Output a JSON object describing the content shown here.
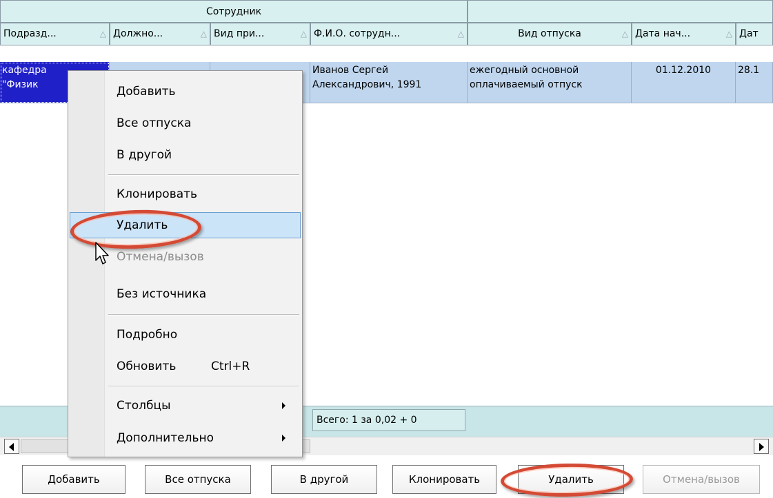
{
  "grid": {
    "group_header": "Сотрудник",
    "columns": [
      {
        "label": "Подразд...",
        "sort": "△"
      },
      {
        "label": "Должно...",
        "sort": "△"
      },
      {
        "label": "Вид при...",
        "sort": "△"
      },
      {
        "label": "Ф.И.О. сотрудн...",
        "sort": "△"
      },
      {
        "label": "Вид отпуска",
        "sort": "△"
      },
      {
        "label": "Дата нач...",
        "sort": "△"
      },
      {
        "label": "Дат"
      }
    ],
    "row": {
      "department": "кафедра\n\"Физик",
      "position": "",
      "hire_type": "",
      "employee": "Иванов Сергей\nАлександрович, 1991",
      "leave_type": "ежегодный основной\nоплачиваемый отпуск",
      "start_date": "01.12.2010",
      "end_date": "28.1"
    },
    "total": "Всего: 1 за 0,02 + 0"
  },
  "context_menu": {
    "items": [
      {
        "label": "Добавить"
      },
      {
        "label": "Все отпуска"
      },
      {
        "label": "В другой"
      },
      {
        "label": "Клонировать"
      },
      {
        "label": "Удалить"
      },
      {
        "label": "Отмена/вызов"
      },
      {
        "label": "Без источника"
      },
      {
        "label": "Подробно"
      },
      {
        "label": "Обновить",
        "shortcut": "Ctrl+R"
      },
      {
        "label": "Столбцы"
      },
      {
        "label": "Дополнительно"
      }
    ]
  },
  "buttons": {
    "add": "Добавить",
    "all_leaves": "Все отпуска",
    "to_other": "В другой",
    "clone": "Клонировать",
    "delete": "Удалить",
    "cancel_recall": "Отмена/вызов"
  },
  "colors": {
    "header_bg": "#d8f0f0",
    "row_bg": "#bfd6ee",
    "selected_cell": "#2020c8",
    "menu_highlight": "#cce4f7",
    "highlight_oval": "#d44a34"
  },
  "icons": {
    "sort": "sort-triangle-icon",
    "submenu": "submenu-arrow-icon",
    "scroll_left": "scroll-left-icon",
    "scroll_right": "scroll-right-icon",
    "cursor": "mouse-pointer-icon"
  }
}
